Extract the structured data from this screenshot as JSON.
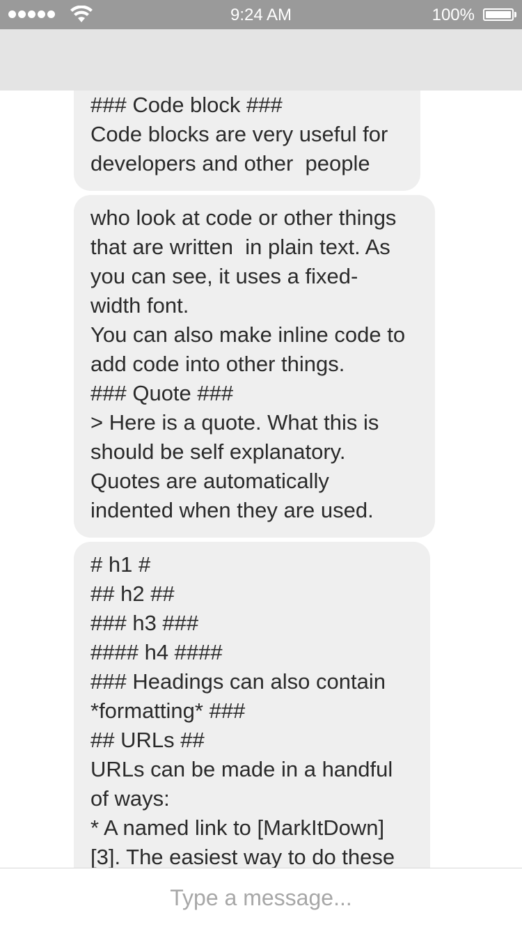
{
  "status_bar": {
    "time": "9:24 AM",
    "battery_percent": "100%",
    "signal_bars": 5,
    "icons": [
      "signal-dots-icon",
      "wifi-icon",
      "battery-icon"
    ]
  },
  "messages": [
    {
      "lines": [
        "### Code block ###",
        "Code blocks are very useful for",
        "developers and other  people"
      ]
    },
    {
      "lines": [
        "who look at code or other things",
        "that are written  in plain text. As",
        "you can see, it uses a fixed-",
        "width font.",
        "You can also make inline code to",
        "add code into other things.",
        "### Quote ###",
        "> Here is a quote. What this is",
        "should be self explanatory.",
        "Quotes are automatically",
        "indented when they are used."
      ]
    },
    {
      "lines": [
        "# h1 #",
        "## h2 ##",
        "### h3 ###",
        "#### h4 ####",
        "### Headings can also contain",
        "*formatting* ###",
        "## URLs ##",
        "URLs can be made in a handful",
        "of ways:",
        "* A named link to [MarkItDown]",
        "[3]. The easiest way to do these"
      ]
    }
  ],
  "input": {
    "placeholder": "Type a message..."
  },
  "colors": {
    "status_bar": "#9a9a9a",
    "nav_bar": "#e4e4e4",
    "bubble": "#efefef",
    "text": "#2a2a2a",
    "placeholder": "#a7a7a7"
  }
}
